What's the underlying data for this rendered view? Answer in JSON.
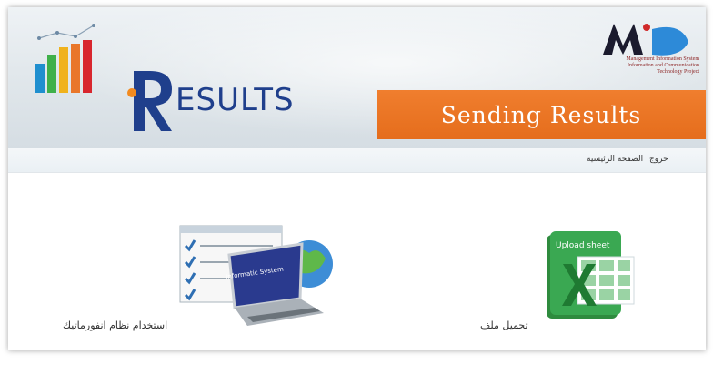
{
  "header": {
    "logo_text": "ESULTS",
    "banner_title": "Sending Results",
    "mis_lines": [
      "Management Information System",
      "Information and Communication",
      "Technology Project"
    ]
  },
  "nav": {
    "logout_label": "خروج",
    "home_label": "الصفحة الرئيسية"
  },
  "tiles": {
    "upload_label": "تحميل ملف",
    "upload_icon_caption": "Upload sheet",
    "system_label": "استخدام نظام انفورماتيك",
    "system_icon_caption": "Informatic System"
  },
  "colors": {
    "banner": "#ec7427",
    "logo_blue": "#1f3f8c"
  }
}
